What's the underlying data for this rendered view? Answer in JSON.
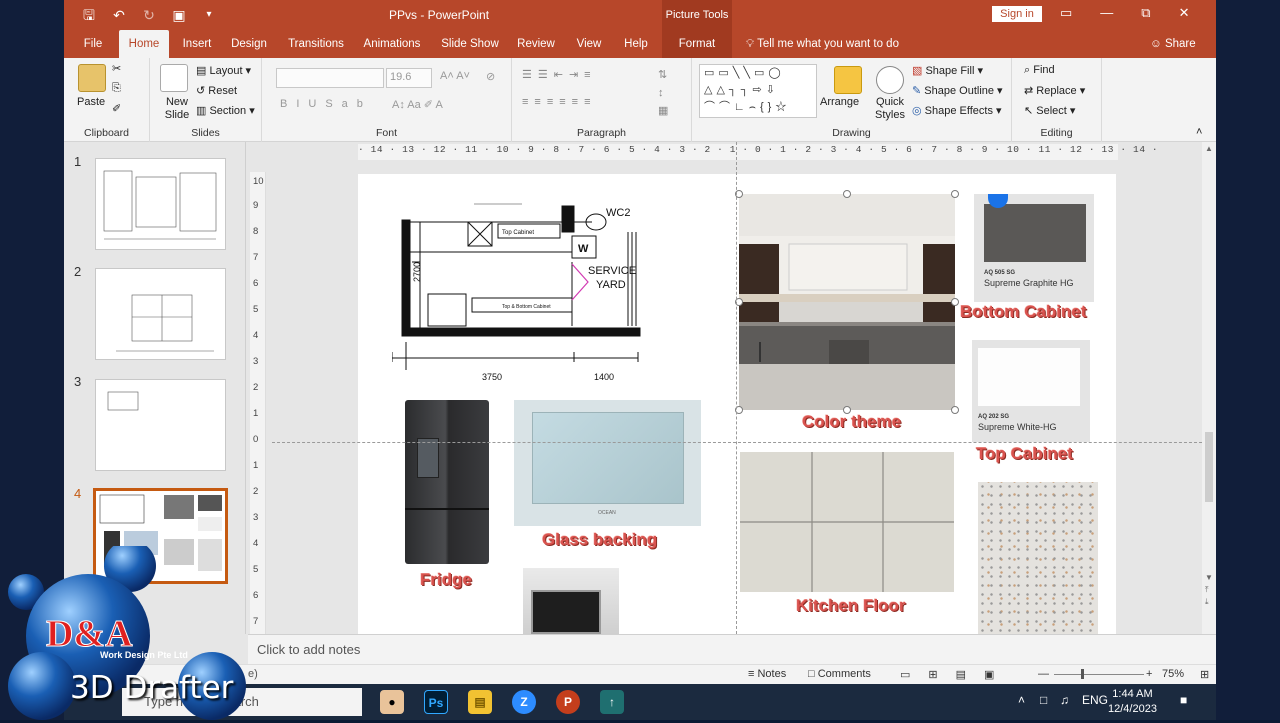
{
  "app": {
    "doc_title": "PPvs - PowerPoint",
    "context_title": "Picture Tools",
    "sign_in": "Sign in"
  },
  "tabs": [
    {
      "label": "File"
    },
    {
      "label": "Home"
    },
    {
      "label": "Insert"
    },
    {
      "label": "Design"
    },
    {
      "label": "Transitions"
    },
    {
      "label": "Animations"
    },
    {
      "label": "Slide Show"
    },
    {
      "label": "Review"
    },
    {
      "label": "View"
    },
    {
      "label": "Help"
    },
    {
      "label": "Format"
    }
  ],
  "tell_me": "Tell me what you want to do",
  "share": "Share",
  "ribbon": {
    "clipboard": {
      "label": "Clipboard",
      "paste": "Paste"
    },
    "slides": {
      "label": "Slides",
      "new_slide": "New Slide",
      "layout": "Layout",
      "reset": "Reset",
      "section": "Section"
    },
    "font": {
      "label": "Font",
      "size": "19.6"
    },
    "paragraph": {
      "label": "Paragraph"
    },
    "drawing": {
      "label": "Drawing",
      "arrange": "Arrange",
      "quick_styles": "Quick Styles",
      "shape_fill": "Shape Fill",
      "shape_outline": "Shape Outline",
      "shape_effects": "Shape Effects"
    },
    "editing": {
      "label": "Editing",
      "find": "Find",
      "replace": "Replace",
      "select": "Select"
    }
  },
  "slide_numbers": [
    "1",
    "2",
    "3",
    "4"
  ],
  "ruler": {
    "h": "· 14 · 13 · 12 · 11 · 10 · 9 · 8 · 7 · 6 · 5 · 4 · 3 · 2 · 1 · 0 · 1 · 2 · 3 · 4 · 5 · 6 · 7 · 8 · 9 · 10 · 11 · 12 · 13 · 14 ·",
    "v": [
      "10",
      "9",
      "8",
      "7",
      "6",
      "5",
      "4",
      "3",
      "2",
      "1",
      "0",
      "1",
      "2",
      "3",
      "4",
      "5",
      "6",
      "7"
    ]
  },
  "slide": {
    "plan": {
      "wc2": "WC2",
      "w": "W",
      "service": "SERVICE",
      "yard": "YARD",
      "top_cabinet": "Top Cabinet",
      "bottom_cabinet": "Top & Bottom Cabinet",
      "dim_3750": "3750",
      "dim_1400": "1400",
      "dim_2700": "2700"
    },
    "labels": {
      "fridge": "Fridge",
      "glass": "Glass backing",
      "color_theme": "Color theme",
      "bottom_cabinet": "Bottom Cabinet",
      "top_cabinet": "Top Cabinet",
      "kitchen_floor": "Kitchen Floor"
    },
    "swatch1": {
      "code": "AQ 505 SG",
      "name": "Supreme Graphite HG"
    },
    "swatch2": {
      "code": "AQ 202 SG",
      "name": "Supreme White-HG"
    },
    "glass_brand": "OCEAN"
  },
  "notes_placeholder": "Click to add notes",
  "status": {
    "notes": "Notes",
    "comments": "Comments",
    "zoom": "75%",
    "left_fragment": "e)"
  },
  "taskbar": {
    "search_placeholder": "Type here to search",
    "time": "1:44 AM",
    "date": "12/4/2023",
    "lang": "ENG"
  },
  "watermark": {
    "company": "Work Design Pte Ltd",
    "tagline": "3D Drafter",
    "logo_letters": "D&A"
  },
  "colors": {
    "accent": "#b7472a",
    "label_red": "#d9534f",
    "selected_thumb": "#c55a11"
  }
}
